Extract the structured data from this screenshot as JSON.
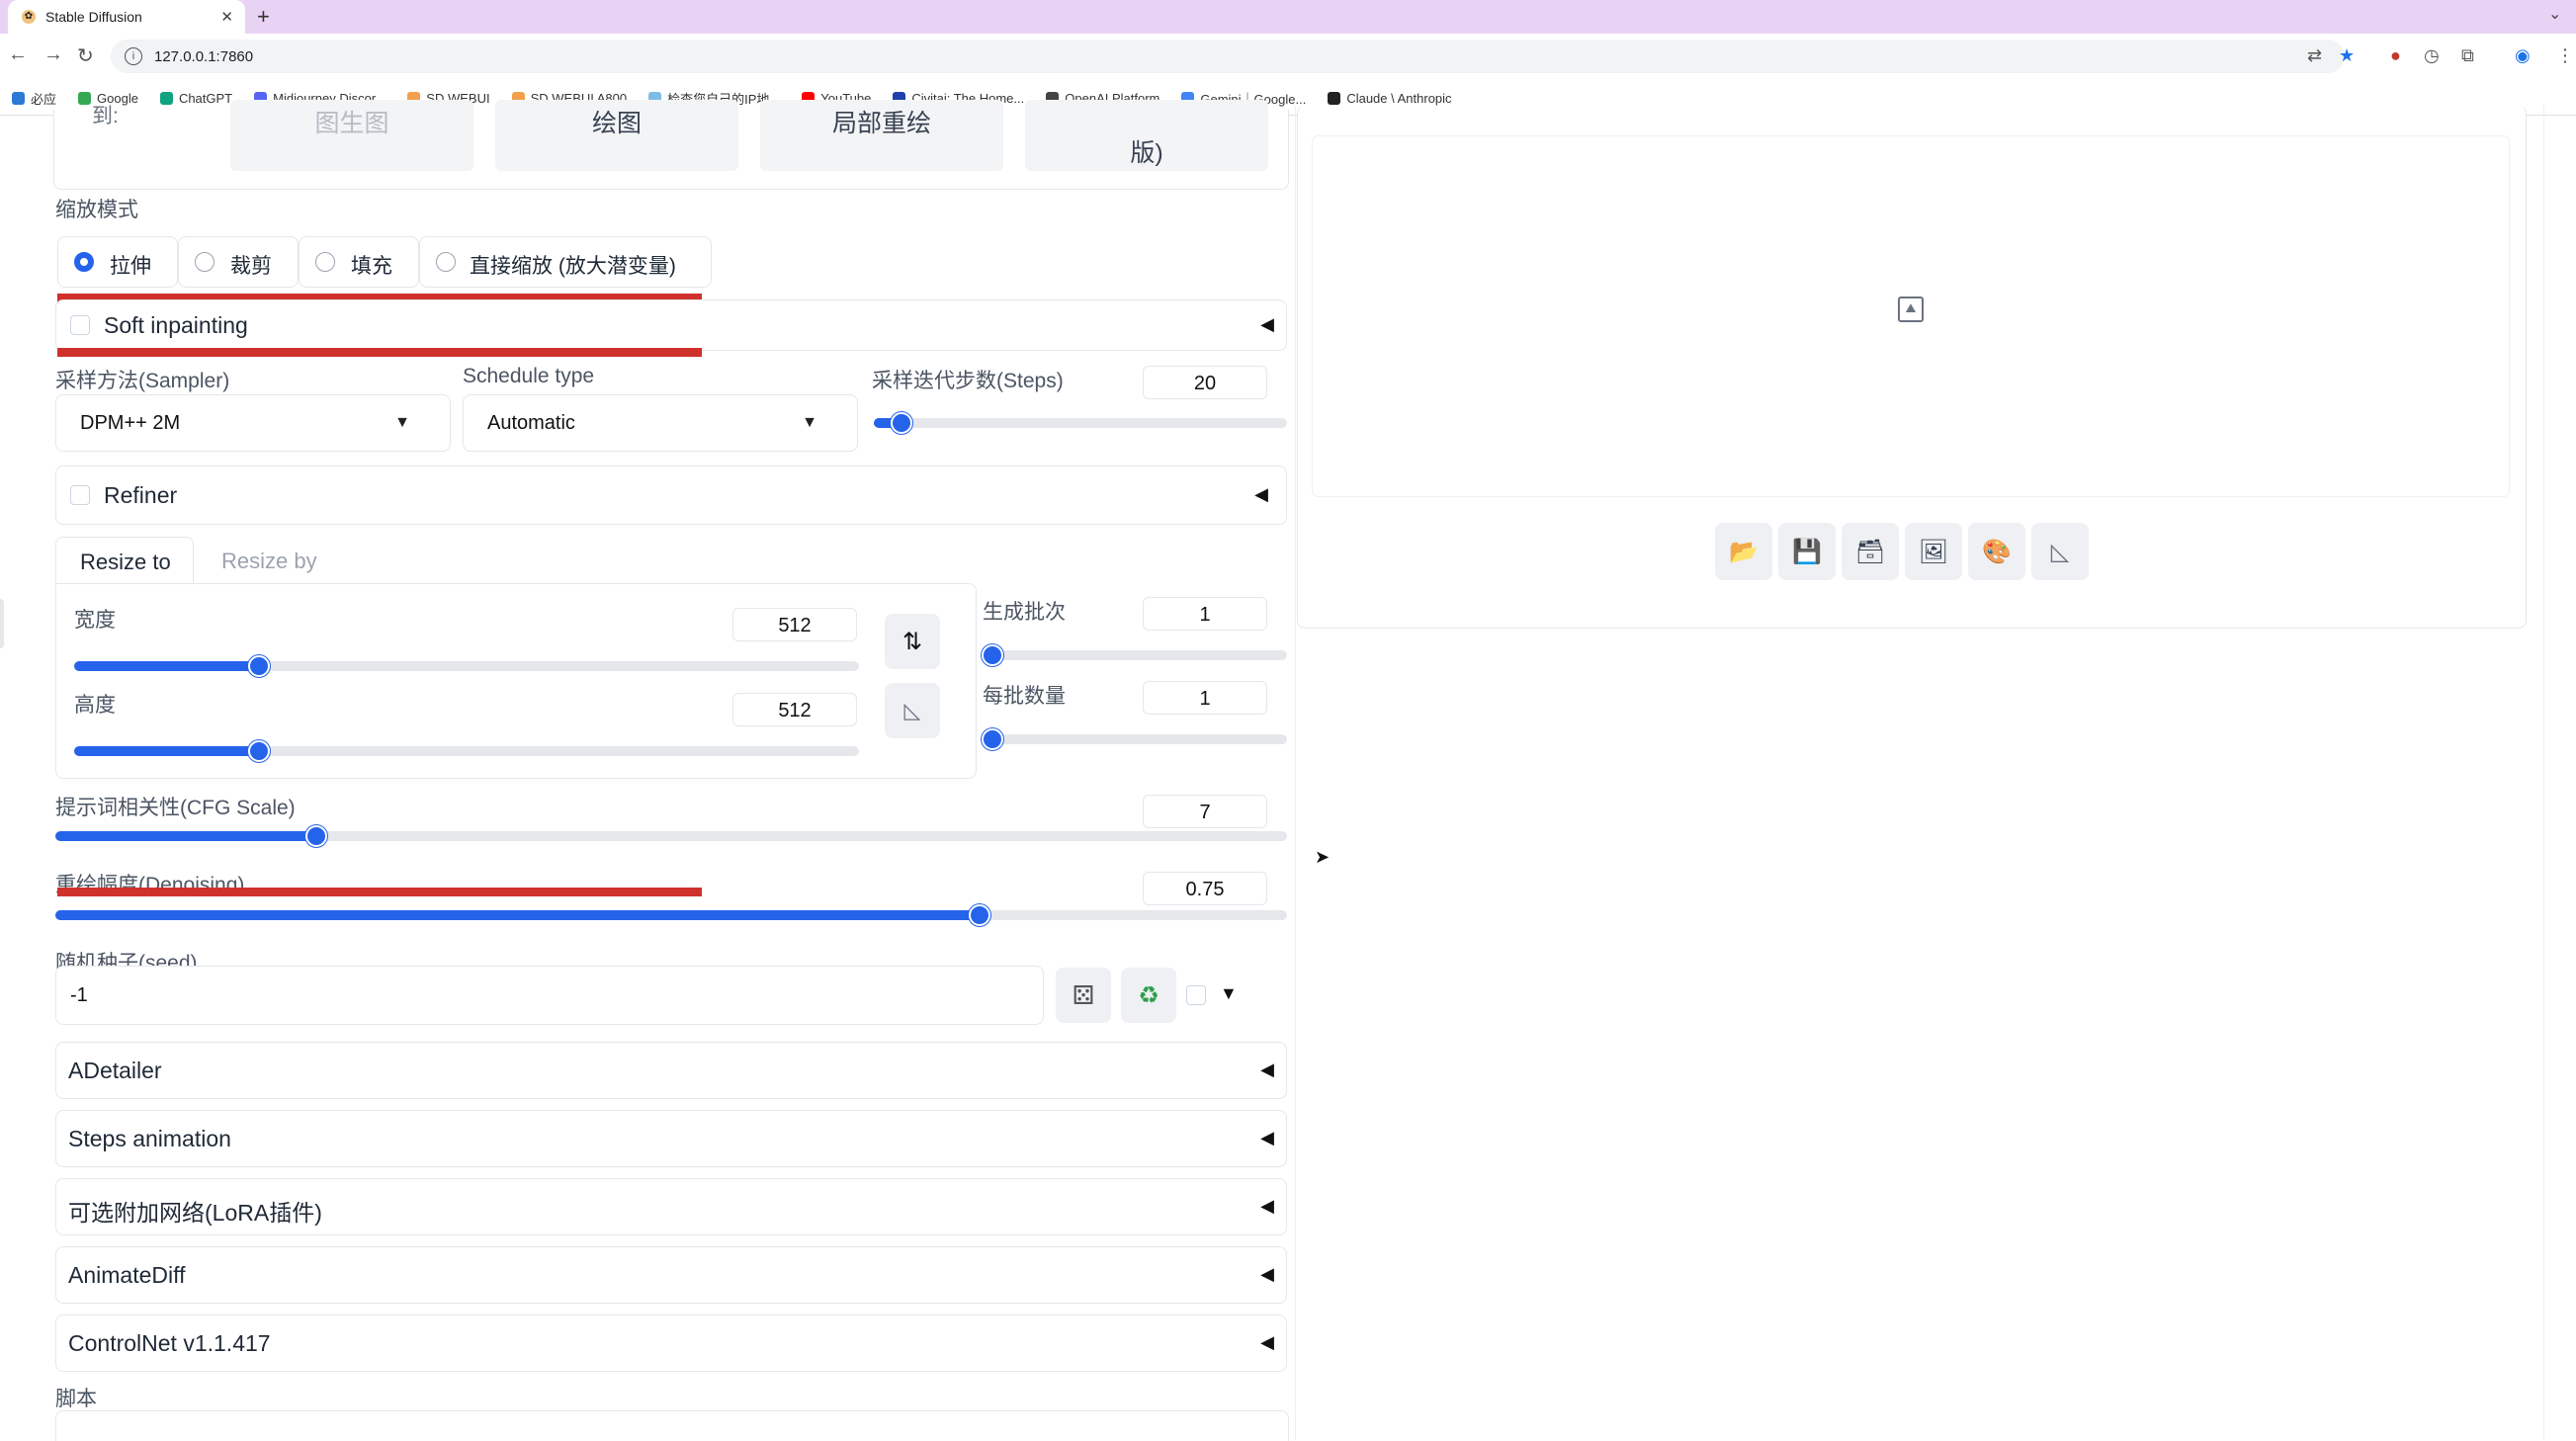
{
  "browser": {
    "tab_title": "Stable Diffusion",
    "tab_close": "✕",
    "new_tab": "+",
    "url": "127.0.0.1:7860",
    "bookmarks": [
      {
        "label": "必应",
        "color": "#2b7bd6"
      },
      {
        "label": "Google",
        "color": "#34a853"
      },
      {
        "label": "ChatGPT",
        "color": "#10a37f"
      },
      {
        "label": "Midjourney Discor...",
        "color": "#5865f2"
      },
      {
        "label": "SD WEBUI",
        "color": "#f1a04c"
      },
      {
        "label": "SD WEBUI A800",
        "color": "#f1a04c"
      },
      {
        "label": "检查您自己的IP地...",
        "color": "#7dbbe8"
      },
      {
        "label": "YouTube",
        "color": "#ff0000"
      },
      {
        "label": "Civitai: The Home...",
        "color": "#1e40af"
      },
      {
        "label": "OpenAI Platform",
        "color": "#444444"
      },
      {
        "label": "Gemini｜Google...",
        "color": "#4285f4"
      },
      {
        "label": "Claude \\ Anthropic",
        "color": "#222222"
      }
    ]
  },
  "top_buttons": {
    "label_prefix": "到:",
    "buttons": [
      "图生图",
      "绘图",
      "局部重绘",
      "版)"
    ]
  },
  "resize_mode": {
    "label": "缩放模式",
    "options": [
      "拉伸",
      "裁剪",
      "填充",
      "直接缩放 (放大潜变量)"
    ],
    "selected": "拉伸"
  },
  "soft_inpainting": {
    "label": "Soft inpainting",
    "arrow": "◀"
  },
  "sampler": {
    "label": "采样方法(Sampler)",
    "value": "DPM++ 2M"
  },
  "schedule": {
    "label": "Schedule type",
    "value": "Automatic"
  },
  "steps": {
    "label": "采样迭代步数(Steps)",
    "value": "20",
    "fraction": 0.068
  },
  "refiner": {
    "label": "Refiner",
    "arrow": "◀"
  },
  "resize_tabs": {
    "active": "Resize to",
    "inactive": "Resize by"
  },
  "width": {
    "label": "宽度",
    "value": "512",
    "fraction": 0.235
  },
  "height": {
    "label": "高度",
    "value": "512",
    "fraction": 0.235
  },
  "batch_count": {
    "label": "生成批次",
    "value": "1",
    "fraction": 0.0
  },
  "batch_size": {
    "label": "每批数量",
    "value": "1",
    "fraction": 0.0
  },
  "cfg": {
    "label": "提示词相关性(CFG Scale)",
    "value": "7",
    "fraction": 0.212
  },
  "denoise": {
    "label": "重绘幅度(Denoising)",
    "value": "0.75",
    "fraction": 0.75
  },
  "seed": {
    "label": "随机种子(seed)",
    "value": "-1",
    "extra_arrow": "▼"
  },
  "accordions": [
    {
      "label": "ADetailer",
      "arrow": "◀"
    },
    {
      "label": "Steps animation",
      "arrow": "◀"
    },
    {
      "label": "可选附加网络(LoRA插件)",
      "arrow": "◀"
    },
    {
      "label": "AnimateDiff",
      "arrow": "◀"
    },
    {
      "label": "ControlNet v1.1.417",
      "arrow": "◀"
    }
  ],
  "script_label": "脚本",
  "colors": {
    "accent": "#2563eb",
    "annotation_red": "#d0312d",
    "tab_strip": "#e9d3f5"
  },
  "icons": {
    "output_tools": [
      "folder-icon",
      "save-icon",
      "zip-icon",
      "image-icon",
      "palette-icon",
      "ruler-icon"
    ]
  }
}
